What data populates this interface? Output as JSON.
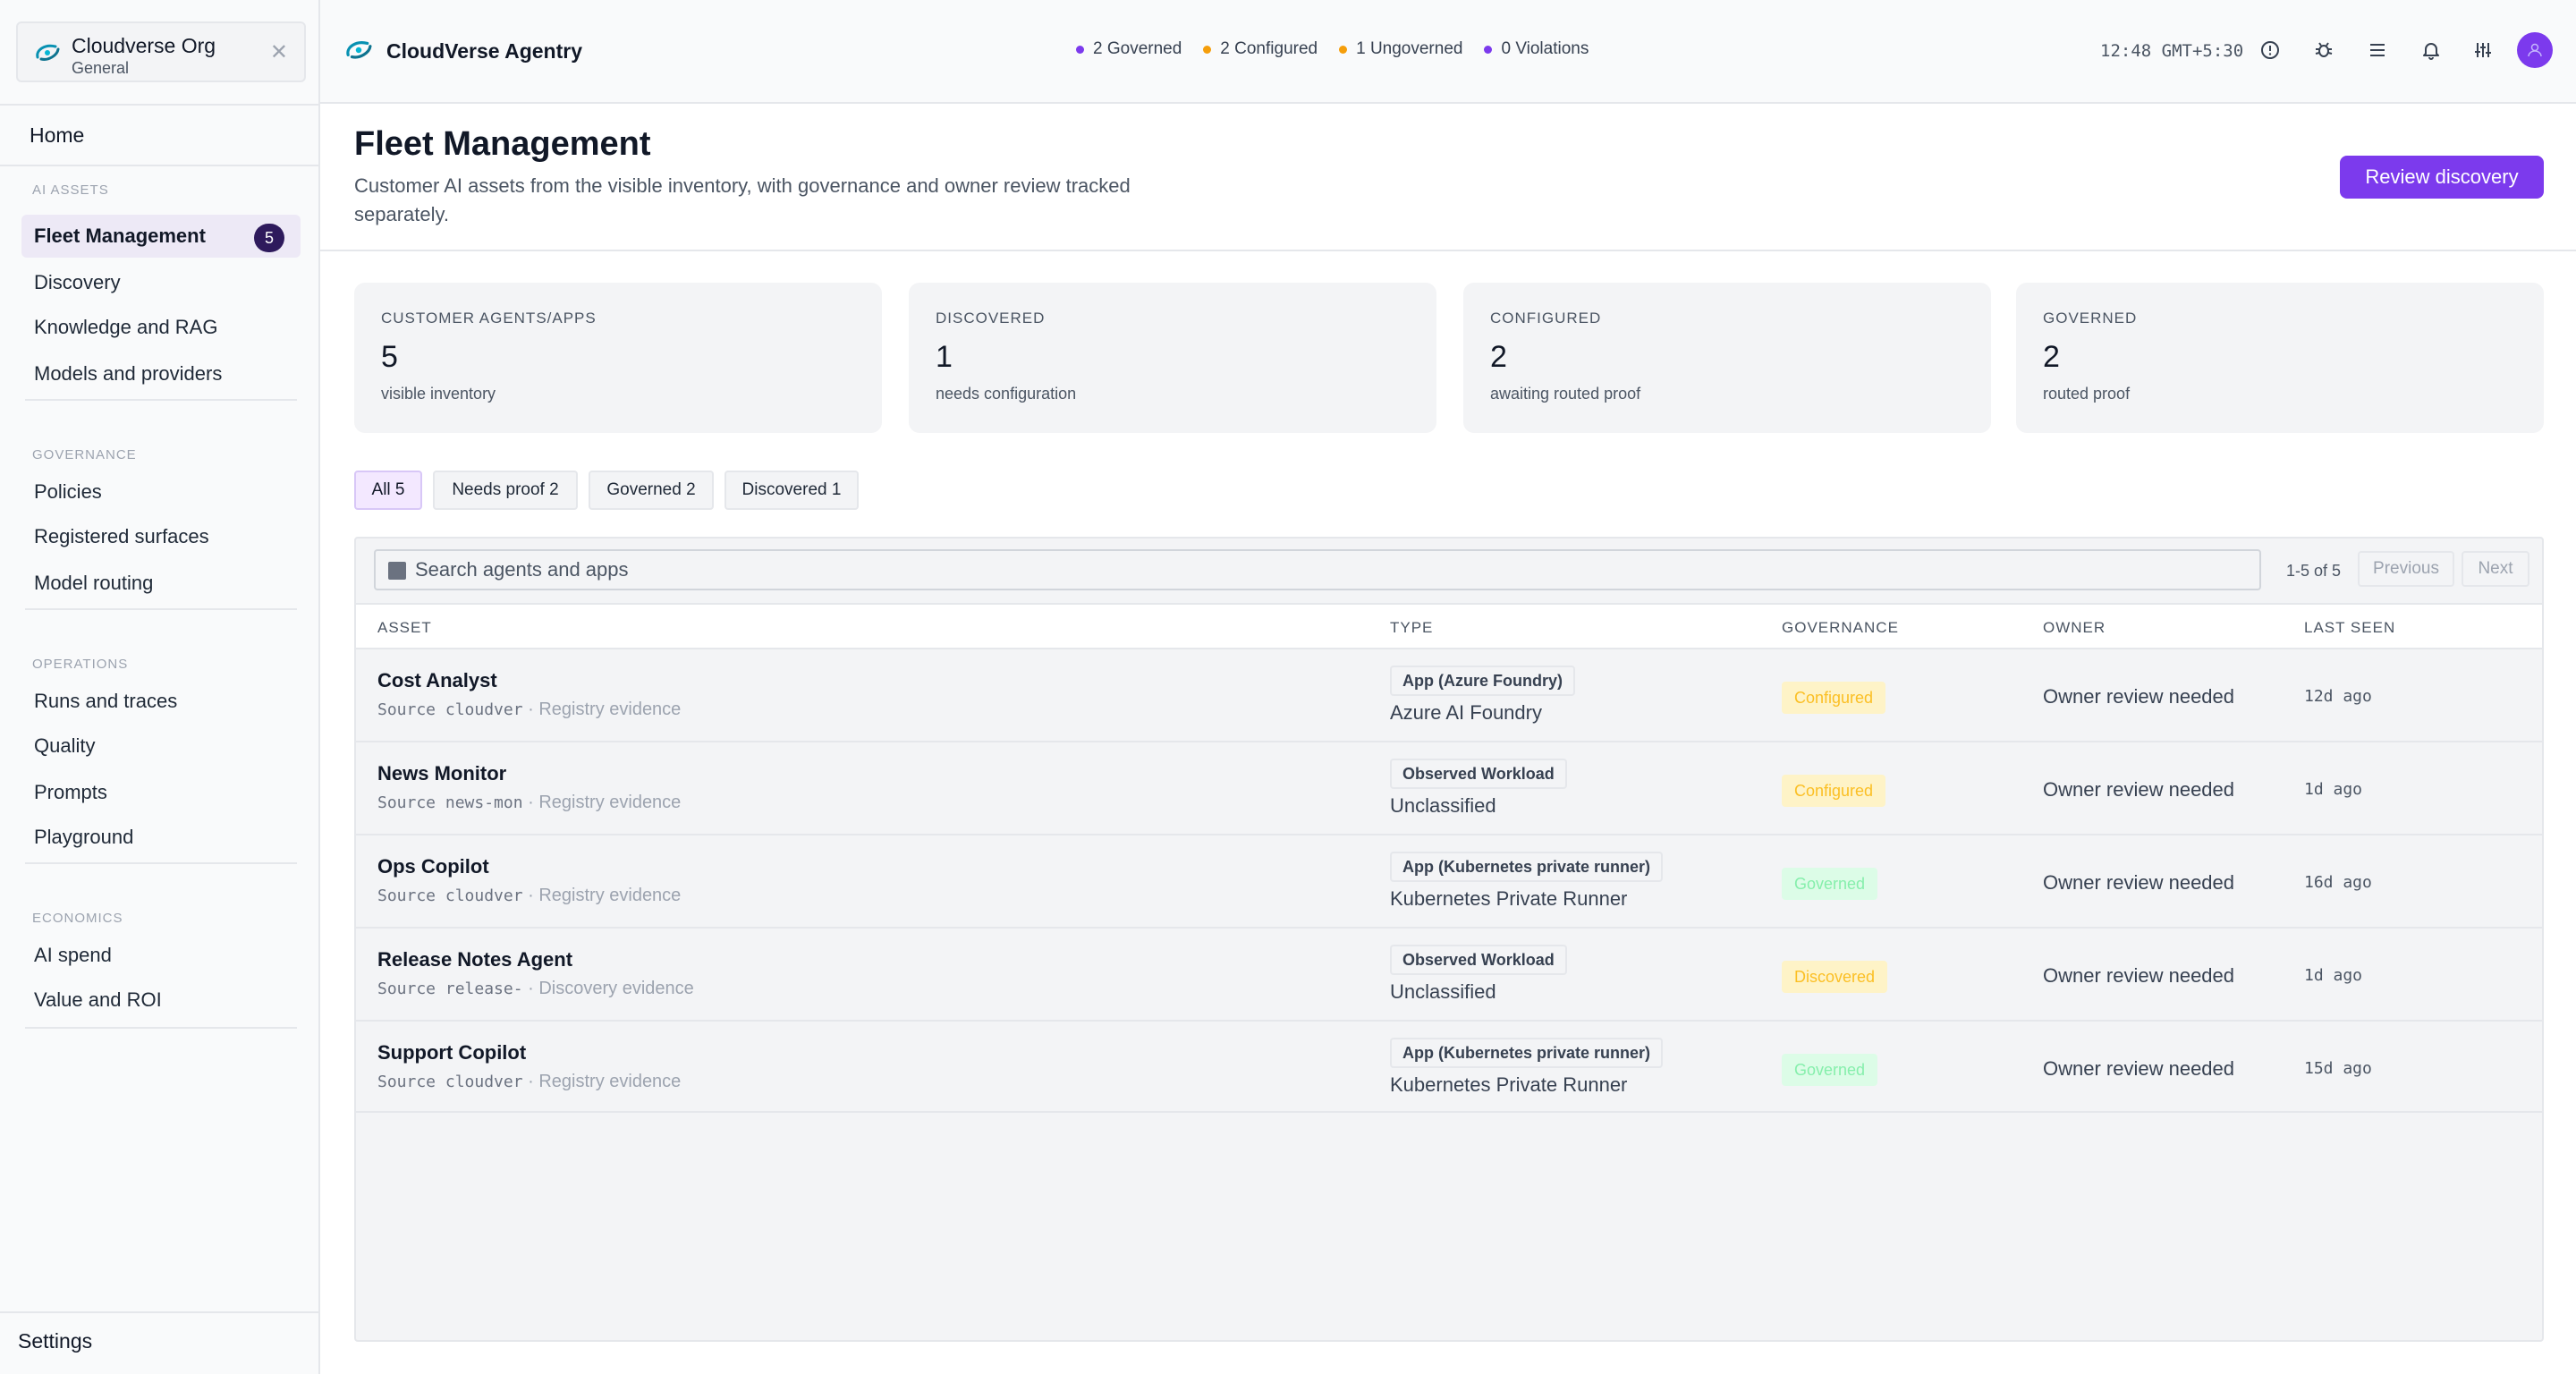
{
  "org": {
    "name": "Cloudverse Org",
    "workspace": "General"
  },
  "sidebar": {
    "home": "Home",
    "sections": [
      {
        "label": "AI ASSETS",
        "items": [
          {
            "label": "Fleet Management",
            "badge": "5",
            "active": true
          },
          {
            "label": "Discovery"
          },
          {
            "label": "Knowledge and RAG"
          },
          {
            "label": "Models and providers"
          }
        ]
      },
      {
        "label": "GOVERNANCE",
        "items": [
          {
            "label": "Policies"
          },
          {
            "label": "Registered surfaces"
          },
          {
            "label": "Model routing"
          }
        ]
      },
      {
        "label": "OPERATIONS",
        "items": [
          {
            "label": "Runs and traces"
          },
          {
            "label": "Quality"
          },
          {
            "label": "Prompts"
          },
          {
            "label": "Playground"
          }
        ]
      },
      {
        "label": "ECONOMICS",
        "items": [
          {
            "label": "AI spend"
          },
          {
            "label": "Value and ROI"
          }
        ]
      }
    ],
    "settings": "Settings"
  },
  "header": {
    "brand": "CloudVerse Agentry",
    "status": [
      {
        "label": "2 Governed",
        "color": "#7c3aed"
      },
      {
        "label": "2 Configured",
        "color": "#f59e0b"
      },
      {
        "label": "1 Ungoverned",
        "color": "#f59e0b"
      },
      {
        "label": "0 Violations",
        "color": "#7c3aed"
      }
    ],
    "clock": "12:48 GMT+5:30",
    "icons": [
      "info-icon",
      "bug-icon",
      "menu-icon",
      "bell-icon",
      "sliders-icon",
      "user-avatar-icon"
    ]
  },
  "page": {
    "title": "Fleet Management",
    "description": "Customer AI assets from the visible inventory, with governance and owner review tracked separately.",
    "primary_action": "Review discovery"
  },
  "stats": [
    {
      "label": "CUSTOMER AGENTS/APPS",
      "value": "5",
      "note": "visible inventory"
    },
    {
      "label": "DISCOVERED",
      "value": "1",
      "note": "needs configuration"
    },
    {
      "label": "CONFIGURED",
      "value": "2",
      "note": "awaiting routed proof"
    },
    {
      "label": "GOVERNED",
      "value": "2",
      "note": "routed proof"
    }
  ],
  "filters": [
    {
      "label": "All 5",
      "active": true
    },
    {
      "label": "Needs proof 2"
    },
    {
      "label": "Governed 2"
    },
    {
      "label": "Discovered 1"
    }
  ],
  "table": {
    "search_placeholder": "Search agents and apps",
    "pager": {
      "range": "1-5 of 5",
      "previous": "Previous",
      "next": "Next"
    },
    "columns": [
      "ASSET",
      "TYPE",
      "GOVERNANCE",
      "OWNER",
      "LAST SEEN"
    ],
    "rows": [
      {
        "name": "Cost Analyst",
        "source_prefix": "Source ",
        "source_code": "cloudver",
        "evidence": "· Registry evidence",
        "type": "App (Azure Foundry)",
        "type_sub": "Azure AI Foundry",
        "governance": "Configured",
        "owner": "Owner review needed",
        "last_seen": "12d ago"
      },
      {
        "name": "News Monitor",
        "source_prefix": "Source ",
        "source_code": "news-mon",
        "evidence": "· Registry evidence",
        "type": "Observed Workload",
        "type_sub": "Unclassified",
        "governance": "Configured",
        "owner": "Owner review needed",
        "last_seen": "1d ago"
      },
      {
        "name": "Ops Copilot",
        "source_prefix": "Source ",
        "source_code": "cloudver",
        "evidence": "· Registry evidence",
        "type": "App (Kubernetes private runner)",
        "type_sub": "Kubernetes Private Runner",
        "governance": "Governed",
        "owner": "Owner review needed",
        "last_seen": "16d ago"
      },
      {
        "name": "Release Notes Agent",
        "source_prefix": "Source ",
        "source_code": "release-",
        "evidence": "· Discovery evidence",
        "type": "Observed Workload",
        "type_sub": "Unclassified",
        "governance": "Discovered",
        "owner": "Owner review needed",
        "last_seen": "1d ago"
      },
      {
        "name": "Support Copilot",
        "source_prefix": "Source ",
        "source_code": "cloudver",
        "evidence": "· Registry evidence",
        "type": "App (Kubernetes private runner)",
        "type_sub": "Kubernetes Private Runner",
        "governance": "Governed",
        "owner": "Owner review needed",
        "last_seen": "15d ago"
      }
    ]
  },
  "colors": {
    "accent": "#7c3aed",
    "governed_bg": "#dcfce7",
    "governed_text": "#86efac",
    "configured_bg": "#fef3c7",
    "configured_text": "#fbbf24",
    "discovered_bg": "#fef3c7",
    "discovered_text": "#fbbf24"
  }
}
